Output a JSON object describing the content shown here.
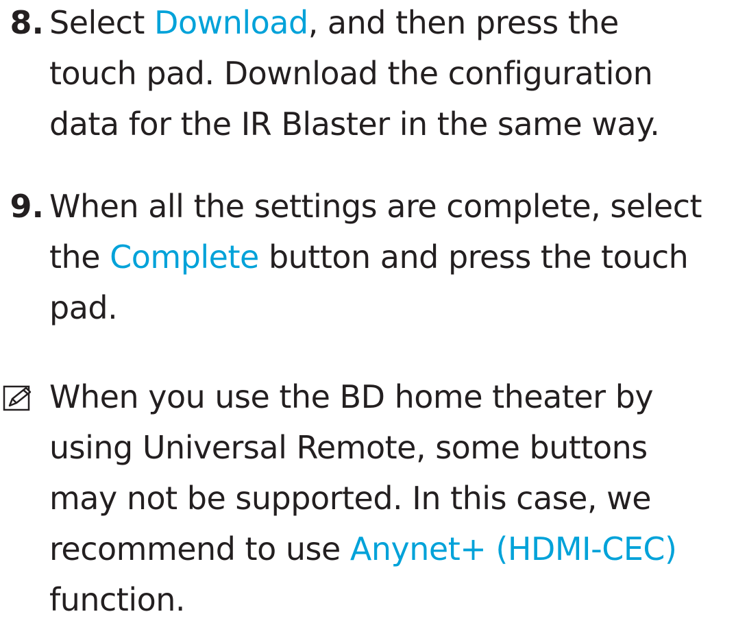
{
  "colors": {
    "text": "#231f20",
    "link": "#00a2d9"
  },
  "steps": [
    {
      "number": "8.",
      "lines": [
        {
          "pre": "Select ",
          "link": "Download",
          "post": ", and then press the"
        },
        {
          "text": "touch pad. Download the configuration"
        },
        {
          "text": "data for the IR Blaster in the same way."
        }
      ]
    },
    {
      "number": "9.",
      "lines": [
        {
          "text": "When all the settings are complete, select"
        },
        {
          "pre": "the ",
          "link": "Complete",
          "post": " button and press the touch"
        },
        {
          "text": "pad."
        }
      ]
    }
  ],
  "note": {
    "icon": "note-pencil-icon",
    "lines": [
      {
        "text": "When you use the BD home theater by"
      },
      {
        "text": "using Universal Remote, some buttons"
      },
      {
        "text": "may not be supported. In this case, we"
      },
      {
        "pre": "recommend to use ",
        "link": "Anynet+ (HDMI-CEC)",
        "post": ""
      },
      {
        "text": "function."
      }
    ]
  }
}
